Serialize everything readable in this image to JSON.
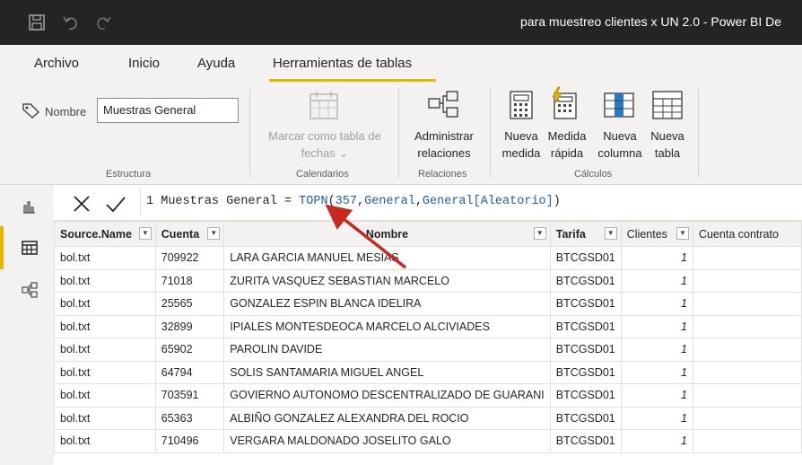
{
  "title_bar": {
    "title": "para muestreo clientes x UN 2.0 - Power BI De"
  },
  "tabs": [
    {
      "label": "Archivo"
    },
    {
      "label": "Inicio"
    },
    {
      "label": "Ayuda"
    },
    {
      "label": "Herramientas de tablas",
      "active": true
    }
  ],
  "ribbon": {
    "estructura": {
      "name_label": "Nombre",
      "name_value": "Muestras General",
      "group_label": "Estructura"
    },
    "calendarios": {
      "mark_label_1": "Marcar como tabla de",
      "mark_label_2": "fechas ⌄",
      "group_label": "Calendarios"
    },
    "relaciones": {
      "manage_label_1": "Administrar",
      "manage_label_2": "relaciones",
      "group_label": "Relaciones"
    },
    "calculos": {
      "new_measure_1": "Nueva",
      "new_measure_2": "medida",
      "quick_measure_1": "Medida",
      "quick_measure_2": "rápida",
      "new_column_1": "Nueva",
      "new_column_2": "columna",
      "new_table_1": "Nueva",
      "new_table_2": "tabla",
      "group_label": "Cálculos"
    }
  },
  "formula_bar": {
    "line_number": "1",
    "prefix": "Muestras General = ",
    "function": "TOPN",
    "open": "(",
    "arg1": "357",
    "sep1": ",",
    "arg2": "General",
    "sep2": ",",
    "arg3": "General[Aleatorio]",
    "close": ")"
  },
  "table": {
    "columns": [
      "Source.Name",
      "Cuenta",
      "Nombre",
      "Tarifa",
      "Clientes",
      "Cuenta contrato"
    ],
    "rows": [
      [
        "bol.txt",
        "709922",
        "LARA GARCIA  MANUEL MESIAS",
        "BTCGSD01",
        "1",
        ""
      ],
      [
        "bol.txt",
        "71018",
        "ZURITA VASQUEZ SEBASTIAN MARCELO",
        "BTCGSD01",
        "1",
        ""
      ],
      [
        "bol.txt",
        "25565",
        "GONZALEZ ESPIN BLANCA IDELIRA",
        "BTCGSD01",
        "1",
        ""
      ],
      [
        "bol.txt",
        "32899",
        "IPIALES MONTESDEOCA MARCELO ALCIVIADES",
        "BTCGSD01",
        "1",
        ""
      ],
      [
        "bol.txt",
        "65902",
        "PAROLIN DAVIDE",
        "BTCGSD01",
        "1",
        ""
      ],
      [
        "bol.txt",
        "64794",
        "SOLIS SANTAMARIA MIGUEL ANGEL",
        "BTCGSD01",
        "1",
        ""
      ],
      [
        "bol.txt",
        "703591",
        "GOVIERNO AUTONOMO  DESCENTRALIZADO DE GUARANI",
        "BTCGSD01",
        "1",
        ""
      ],
      [
        "bol.txt",
        "65363",
        "ALBIÑO GONZALEZ ALEXANDRA DEL ROCIO",
        "BTCGSD01",
        "1",
        ""
      ],
      [
        "bol.txt",
        "710496",
        "VERGARA MALDONADO JOSELITO GALO",
        "BTCGSD01",
        "1",
        ""
      ]
    ]
  },
  "colors": {
    "accent": "#e8b400",
    "annotation_arrow": "#c8281e",
    "title_bar": "#252423"
  }
}
